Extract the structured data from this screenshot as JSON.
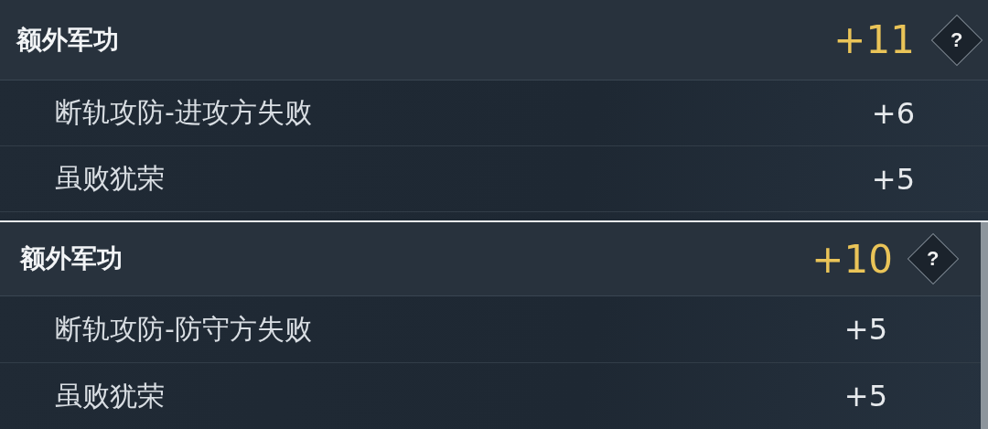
{
  "panels": [
    {
      "title": "额外军功",
      "total": "+11",
      "help": "?",
      "items": [
        {
          "label": "断轨攻防-进攻方失败",
          "value": "+6"
        },
        {
          "label": "虽败犹荣",
          "value": "+5"
        }
      ]
    },
    {
      "title": "额外军功",
      "total": "+10",
      "help": "?",
      "items": [
        {
          "label": "断轨攻防-防守方失败",
          "value": "+5"
        },
        {
          "label": "虽败犹荣",
          "value": "+5"
        }
      ]
    }
  ]
}
